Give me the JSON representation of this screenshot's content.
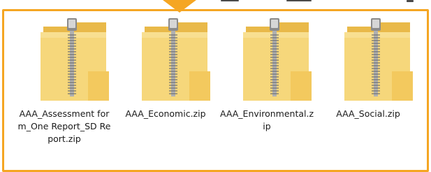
{
  "window": {
    "accent_color": "#f5a623",
    "folder_color": "#f6d77b",
    "zipper_color": "#9a9a9a"
  },
  "files": [
    {
      "label": "AAA_Assessment form_One Report_SD Report.zip",
      "icon": "zip-folder-icon"
    },
    {
      "label": "AAA_Economic.zip",
      "icon": "zip-folder-icon"
    },
    {
      "label": "AAA_Environmental.zip",
      "icon": "zip-folder-icon"
    },
    {
      "label": "AAA_Social.zip",
      "icon": "zip-folder-icon"
    }
  ]
}
